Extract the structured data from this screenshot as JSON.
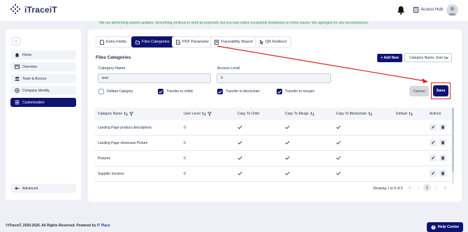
{
  "app": {
    "name": "iTraceiT"
  },
  "header": {
    "hub_label": "Access Hub"
  },
  "banner": {
    "text": "We are performing system updates. Everything continue to work as expected, but you may notice occasional slowdowns or minor issues. We apologize for any inconvenience."
  },
  "sidebar": {
    "items": [
      {
        "label": "Home",
        "icon": "home-icon"
      },
      {
        "label": "Overview",
        "icon": "overview-icon"
      },
      {
        "label": "Team & Access",
        "icon": "team-icon"
      },
      {
        "label": "Company Identity",
        "icon": "company-icon"
      },
      {
        "label": "Customization",
        "icon": "customization-icon",
        "active": true
      }
    ],
    "advanced_label": "Advanced"
  },
  "tabs": [
    {
      "label": "Extra Fields"
    },
    {
      "label": "Files Categories",
      "active": true
    },
    {
      "label": "PDF Parameter"
    },
    {
      "label": "Traceability Report"
    },
    {
      "label": "QR Redirect"
    }
  ],
  "section": {
    "title": "Files Categories"
  },
  "toolbar": {
    "add_label": "+ Add New",
    "select_value": "Category Name, User L..."
  },
  "form": {
    "category_name_label": "Category Name",
    "category_name_value": "test",
    "access_level_label": "Access Level",
    "access_level_value": "0",
    "checkboxes": [
      {
        "label": "Default Category",
        "checked": false
      },
      {
        "label": "Transfer to childs",
        "checked": true
      },
      {
        "label": "Transfer to blockchain",
        "checked": true
      },
      {
        "label": "Transfer to merges",
        "checked": true
      }
    ],
    "cancel_label": "Cancel",
    "save_label": "Save"
  },
  "table": {
    "columns": [
      "Category Name",
      "User Level",
      "Copy To Child",
      "Copy To Merge",
      "Copy To Blockchain",
      "Default",
      "Actions"
    ],
    "rows": [
      {
        "name": "Landing Page product descriptions",
        "level": "0",
        "child": true,
        "merge": true,
        "blockchain": true,
        "default": false
      },
      {
        "name": "Landing Page showcase Picture",
        "level": "0",
        "child": true,
        "merge": true,
        "blockchain": true,
        "default": false
      },
      {
        "name": "Pictures",
        "level": "0",
        "child": true,
        "merge": true,
        "blockchain": true,
        "default": false
      },
      {
        "name": "Supplier invoices",
        "level": "0",
        "child": true,
        "merge": true,
        "blockchain": true,
        "default": false
      }
    ]
  },
  "pagination": {
    "info": "Showing 1 to 5 of 5",
    "current": "1",
    "first": "«",
    "prev": "‹",
    "next": "›",
    "last": "»"
  },
  "footer": {
    "copyright": "©iTraceiT, 2020-2026. All Rights Reserved. Powered by",
    "brand": "IT Place"
  },
  "help": {
    "label": "Help Center"
  },
  "colors": {
    "primary": "#0e1470",
    "banner_green": "#2e9b4f",
    "highlight_red": "#e02020"
  }
}
